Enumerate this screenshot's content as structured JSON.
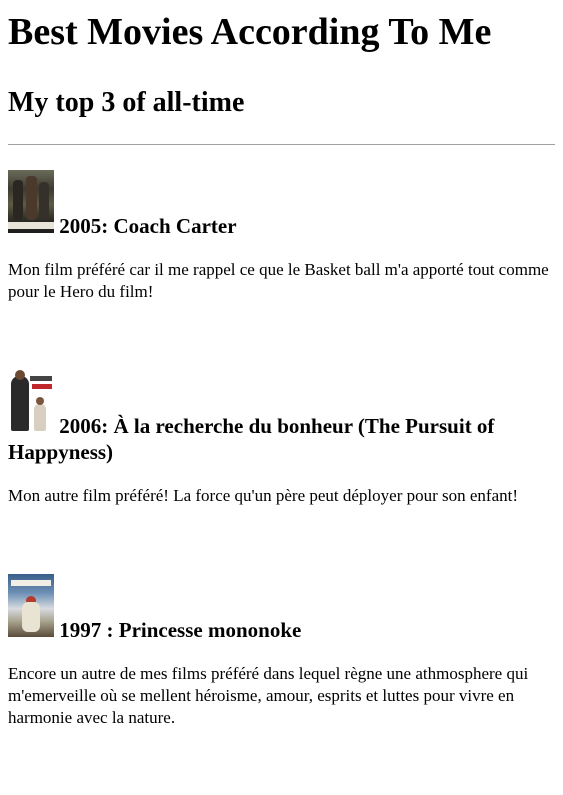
{
  "page": {
    "title": "Best Movies According To Me",
    "subtitle": "My top 3 of all-time"
  },
  "movies": [
    {
      "heading": "2005: Coach Carter",
      "poster_icon": "coach-carter-poster",
      "description": "Mon film préféré car il me rappel ce que le Basket ball m'a apporté tout comme pour le Hero du film!"
    },
    {
      "heading": "2006: À la recherche du bonheur (The Pursuit of Happyness)",
      "poster_icon": "pursuit-of-happyness-poster",
      "description": "Mon autre film préféré! La force qu'un père peut déployer pour son enfant!"
    },
    {
      "heading": "1997 : Princesse mononoke",
      "poster_icon": "princess-mononoke-poster",
      "description": "Encore un autre de mes films préféré dans lequel règne une athmosphere qui m'emerveille où se mellent héroisme, amour, esprits et luttes pour vivre en harmonie avec la nature."
    }
  ],
  "colors": {
    "text": "#000000",
    "background": "#ffffff",
    "rule": "#a0a0a0"
  }
}
